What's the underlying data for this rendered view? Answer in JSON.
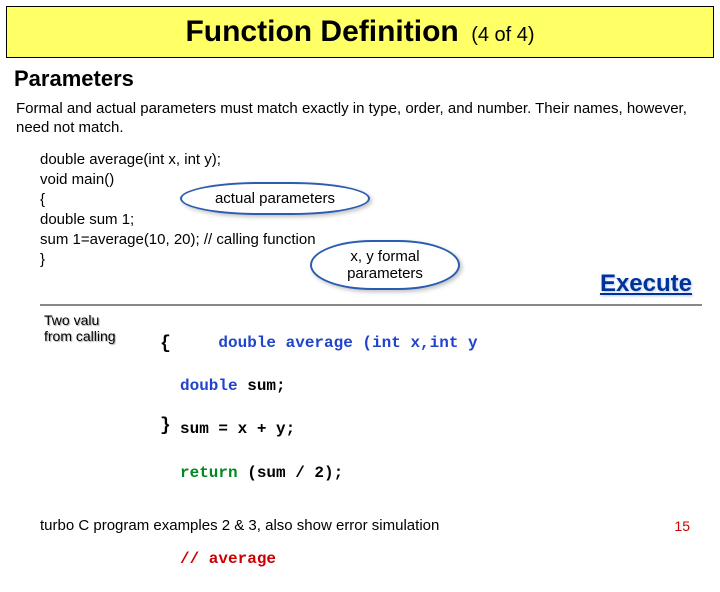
{
  "title": {
    "main": "Function Definition",
    "sub": "(4 of 4)"
  },
  "section_heading": "Parameters",
  "explanation": "Formal and actual parameters must match exactly in type, order, and number. Their names, however,  need not match.",
  "code1": {
    "l0": "double average(int x, int y);",
    "l1": "void main()",
    "l2": "{",
    "l3": "double sum 1;",
    "l4": "sum 1=average(10, 20); // calling function",
    "l5": "}"
  },
  "bubbles": {
    "actual": "actual parameters",
    "formal": "x, y formal parameters"
  },
  "execute": "Execute",
  "faint_label_l1": "Two valu",
  "faint_label_l2": "from calling",
  "cpp": {
    "sig": "double average (int x,int y",
    "sum_decl_kw": "double",
    "sum_decl_rest": " sum;",
    "assign": "sum = x + y;",
    "return_kw": "return",
    "return_rest": " (sum / 2);",
    "comment": "// average"
  },
  "footer": "turbo C program examples 2 & 3, also show error simulation",
  "page_number": "15"
}
